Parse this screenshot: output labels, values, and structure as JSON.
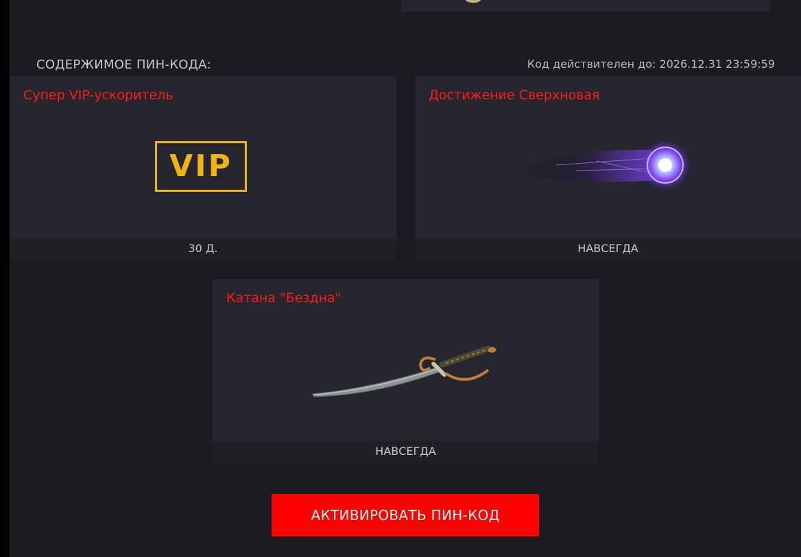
{
  "section_title": "СОДЕРЖИМОЕ ПИН-КОДА:",
  "valid_until": "Код действителен до: 2026.12.31 23:59:59",
  "items": [
    {
      "title": "Супер VIP-ускоритель",
      "duration": "30 Д.",
      "badge_text": "VIP",
      "icon": "vip-badge-icon"
    },
    {
      "title": "Достижение Сверхновая",
      "duration": "НАВСЕГДА",
      "icon": "supernova-achievement-icon"
    },
    {
      "title": "Катана \"Бездна\"",
      "duration": "НАВСЕГДА",
      "icon": "katana-icon"
    }
  ],
  "activate_button": "АКТИВИРОВАТЬ ПИН-КОД",
  "colors": {
    "background": "#1b1c22",
    "card": "#25262e",
    "accent_red": "#ff0000",
    "title_red": "#ff1a1a",
    "vip_gold": "#f0b511"
  }
}
